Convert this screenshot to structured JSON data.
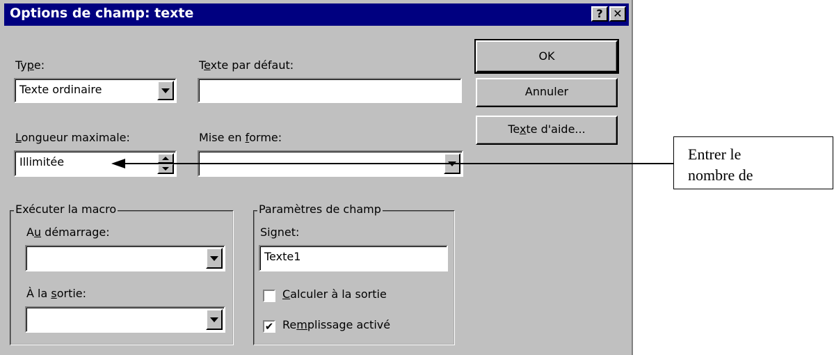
{
  "dialog": {
    "title": "Options de champ: texte",
    "help_label": "?",
    "close_label": "✕"
  },
  "type": {
    "label_pre": "Ty",
    "label_u": "p",
    "label_post": "e:",
    "value": "Texte ordinaire"
  },
  "default_text": {
    "label_pre": "T",
    "label_u": "e",
    "label_post": "xte par défaut:",
    "value": ""
  },
  "max_length": {
    "label_pre": "",
    "label_u": "L",
    "label_post": "ongueur maximale:",
    "value": "Illimitée"
  },
  "format": {
    "label_pre": "Mise en ",
    "label_u": "f",
    "label_post": "orme:",
    "value": ""
  },
  "buttons": {
    "ok": "OK",
    "cancel": "Annuler",
    "help_pre": "Te",
    "help_u": "x",
    "help_post": "te d'aide..."
  },
  "macro_group": {
    "title": "Exécuter la macro",
    "entry_pre": "A",
    "entry_u": "u",
    "entry_post": " démarrage:",
    "entry_value": "",
    "exit_pre": "À la ",
    "exit_u": "s",
    "exit_post": "ortie:",
    "exit_value": ""
  },
  "field_settings": {
    "title": "Paramètres de champ",
    "bookmark_pre": "Si",
    "bookmark_u": "g",
    "bookmark_post": "net:",
    "bookmark_value": "Texte1",
    "calc_u": "C",
    "calc_post": "alculer à la sortie",
    "calc_checked": false,
    "fill_pre": "Re",
    "fill_u": "m",
    "fill_post": "plissage activé",
    "fill_checked": true,
    "check_mark": "✔"
  },
  "callout": {
    "line1": "Entrer le",
    "line2": "nombre de"
  },
  "colors": {
    "titlebar": "#000080",
    "face": "#c0c0c0"
  }
}
